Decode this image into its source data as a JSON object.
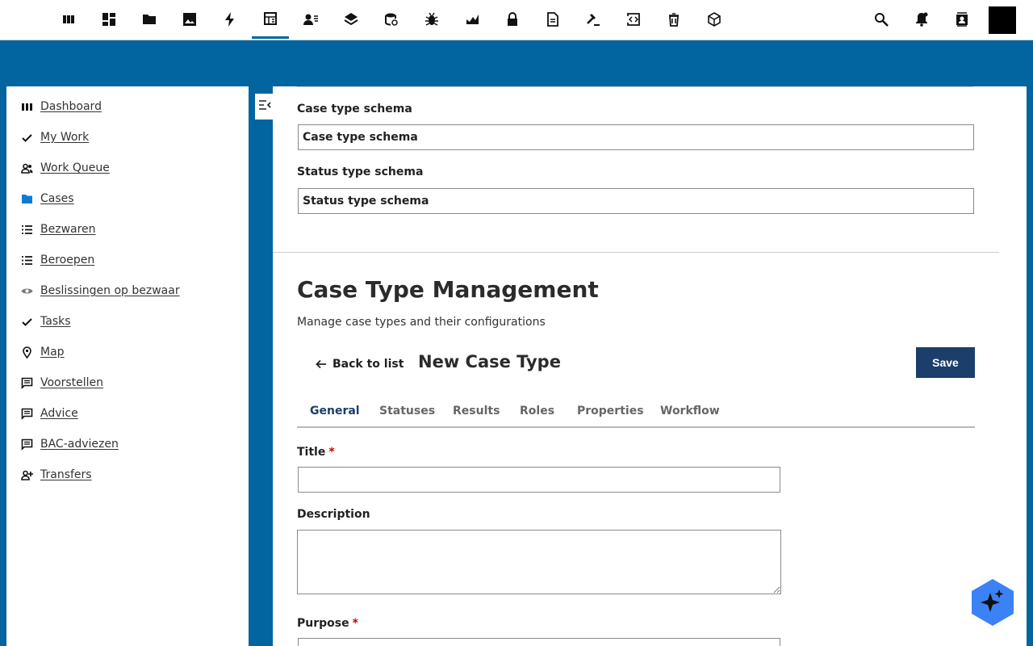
{
  "topbar": {
    "icons": [
      "apps-icon",
      "dashboard-icon",
      "folder-icon",
      "image-icon",
      "bolt-icon",
      "table-icon",
      "users-list-icon",
      "layers-icon",
      "database-icon",
      "bug-icon",
      "chart-icon",
      "lock-icon",
      "document-icon",
      "gavel-icon",
      "code-icon",
      "trash-icon",
      "cube-icon"
    ],
    "active_index": 5,
    "right_icons": [
      "search-icon",
      "bell-icon",
      "contacts-icon"
    ]
  },
  "sidebar": {
    "items": [
      {
        "label": "Dashboard",
        "icon": "dashboard-icon"
      },
      {
        "label": "My Work",
        "icon": "check-icon"
      },
      {
        "label": "Work Queue",
        "icon": "people-icon"
      },
      {
        "label": "Cases",
        "icon": "folder-icon"
      },
      {
        "label": "Bezwaren",
        "icon": "list-icon"
      },
      {
        "label": "Beroepen",
        "icon": "list-icon"
      },
      {
        "label": "Beslissingen op bezwaar",
        "icon": "eye-icon"
      },
      {
        "label": "Tasks",
        "icon": "check-icon"
      },
      {
        "label": "Map",
        "icon": "location-pin-icon"
      },
      {
        "label": "Voorstellen",
        "icon": "comment-icon"
      },
      {
        "label": "Advice",
        "icon": "comment-icon"
      },
      {
        "label": "BAC-adviezen",
        "icon": "comment-icon"
      },
      {
        "label": "Transfers",
        "icon": "person-add-icon"
      }
    ],
    "accent_color": "#0a7bd6"
  },
  "settings": {
    "case_type_schema_label": "Case type schema",
    "case_type_schema_value": "Case type schema",
    "status_type_schema_label": "Status type schema",
    "status_type_schema_value": "Status type schema"
  },
  "management": {
    "title": "Case Type Management",
    "subtitle": "Manage case types and their configurations",
    "back_label": "Back to list",
    "form_title": "New Case Type",
    "save_label": "Save",
    "tabs": [
      "General",
      "Statuses",
      "Results",
      "Roles",
      "Properties",
      "Workflow"
    ],
    "active_tab": "General"
  },
  "form": {
    "title_label": "Title",
    "title_value": "",
    "description_label": "Description",
    "description_value": "",
    "purpose_label": "Purpose",
    "required_marker": "*"
  },
  "colors": {
    "brand_blue": "#02659f",
    "primary_button": "#1b3e6b",
    "fab": "#3b82f6"
  }
}
